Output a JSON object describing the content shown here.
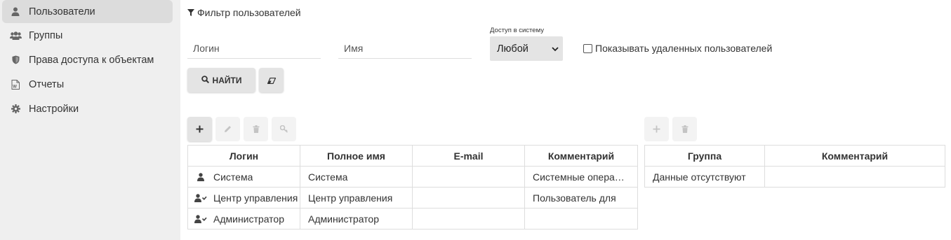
{
  "sidebar": {
    "items": [
      {
        "label": "Пользователи",
        "icon": "user-icon",
        "active": true
      },
      {
        "label": "Группы",
        "icon": "users-icon",
        "active": false
      },
      {
        "label": "Права доступа к объектам",
        "icon": "shield-icon",
        "active": false
      },
      {
        "label": "Отчеты",
        "icon": "report-icon",
        "active": false
      },
      {
        "label": "Настройки",
        "icon": "gear-icon",
        "active": false
      }
    ]
  },
  "filter": {
    "title": "Фильтр пользователей",
    "login_placeholder": "Логин",
    "name_placeholder": "Имя",
    "access_label": "Доступ в систему",
    "access_value": "Любой",
    "show_deleted_label": "Показывать удаленных пользователей",
    "show_deleted_checked": false,
    "find_label": "НАЙТИ"
  },
  "users_table": {
    "headers": [
      "Логин",
      "Полное имя",
      "E-mail",
      "Комментарий"
    ],
    "rows": [
      {
        "login": "Система",
        "fullname": "Система",
        "email": "",
        "comment": "Системные операции",
        "icon": "user-icon"
      },
      {
        "login": "Центр управления",
        "fullname": "Центр управления",
        "email": "",
        "comment": "Пользователь для",
        "icon": "user-check-icon"
      },
      {
        "login": "Администратор",
        "fullname": "Администратор",
        "email": "",
        "comment": "",
        "icon": "user-check-icon"
      }
    ]
  },
  "groups_table": {
    "headers": [
      "Группа",
      "Комментарий"
    ],
    "empty_text": "Данные отсутствуют"
  }
}
